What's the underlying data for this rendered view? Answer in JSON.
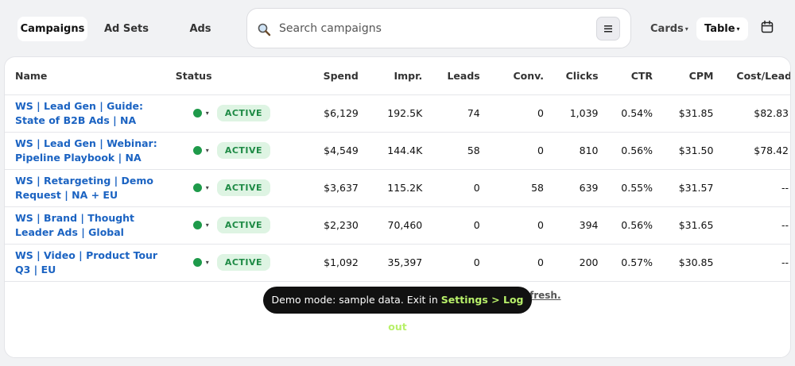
{
  "tabs": [
    "Campaigns",
    "Ad Sets",
    "Ads"
  ],
  "search": {
    "placeholder": "Search campaigns"
  },
  "views": {
    "cards": "Cards",
    "table": "Table"
  },
  "table": {
    "headers": [
      "Name",
      "Status",
      "Spend",
      "Impr.",
      "Leads",
      "Conv.",
      "Clicks",
      "CTR",
      "CPM",
      "Cost/Lead"
    ],
    "rows": [
      {
        "name": "WS | Lead Gen | Guide: State of B2B Ads | NA",
        "status": "ACTIVE",
        "spend": "$6,129",
        "impr": "192.5K",
        "leads": "74",
        "conv": "0",
        "clicks": "1,039",
        "ctr": "0.54%",
        "cpm": "$31.85",
        "cost_lead": "$82.83"
      },
      {
        "name": "WS | Lead Gen | Webinar: Pipeline Playbook | NA",
        "status": "ACTIVE",
        "spend": "$4,549",
        "impr": "144.4K",
        "leads": "58",
        "conv": "0",
        "clicks": "810",
        "ctr": "0.56%",
        "cpm": "$31.50",
        "cost_lead": "$78.42"
      },
      {
        "name": "WS | Retargeting | Demo Request | NA + EU",
        "status": "ACTIVE",
        "spend": "$3,637",
        "impr": "115.2K",
        "leads": "0",
        "conv": "58",
        "clicks": "639",
        "ctr": "0.55%",
        "cpm": "$31.57",
        "cost_lead": "--"
      },
      {
        "name": "WS | Brand | Thought Leader Ads | Global",
        "status": "ACTIVE",
        "spend": "$2,230",
        "impr": "70,460",
        "leads": "0",
        "conv": "0",
        "clicks": "394",
        "ctr": "0.56%",
        "cpm": "$31.65",
        "cost_lead": "--"
      },
      {
        "name": "WS | Video | Product Tour Q3 | EU",
        "status": "ACTIVE",
        "spend": "$1,092",
        "impr": "35,397",
        "leads": "0",
        "conv": "0",
        "clicks": "200",
        "ctr": "0.57%",
        "cpm": "$30.85",
        "cost_lead": "--"
      }
    ]
  },
  "refresh_text": "fresh.",
  "toast": {
    "text": "Demo mode: sample data. Exit in ",
    "highlight": "Settings > Log out"
  },
  "colors": {
    "accent_link": "#1b63c2",
    "active_green": "#1e9a4a",
    "badge_bg": "#def4e3",
    "toast_highlight": "#b8f06a"
  },
  "icons": [
    "search-icon",
    "filter-icon",
    "chevron-down-icon",
    "calendar-icon"
  ]
}
